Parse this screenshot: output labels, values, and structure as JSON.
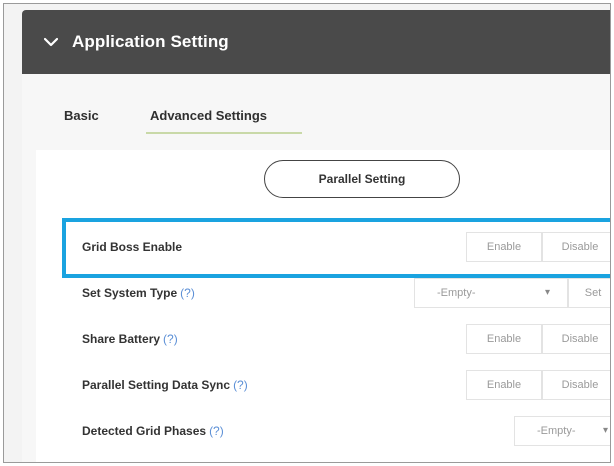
{
  "header": {
    "title": "Application Setting",
    "chevron_icon": "chevron-down-icon"
  },
  "tabs": [
    {
      "label": "Basic",
      "active": false
    },
    {
      "label": "Advanced Settings",
      "active": true
    }
  ],
  "parallel_setting_button": "Parallel Setting",
  "rows": {
    "grid_boss": {
      "label": "Grid Boss Enable",
      "enable": "Enable",
      "disable": "Disable"
    },
    "system_type": {
      "label": "Set System Type",
      "help": "(?)",
      "select_value": "-Empty-",
      "set": "Set"
    },
    "share_battery": {
      "label": "Share Battery",
      "help": "(?)",
      "enable": "Enable",
      "disable": "Disable"
    },
    "data_sync": {
      "label": "Parallel Setting Data Sync",
      "help": "(?)",
      "enable": "Enable",
      "disable": "Disable"
    },
    "grid_phases": {
      "label": "Detected Grid Phases",
      "help": "(?)",
      "select_value": "-Empty-"
    }
  },
  "colors": {
    "header_bg": "#4a4a4a",
    "highlight": "#1aa3e0",
    "help_link": "#5b8fd6"
  }
}
